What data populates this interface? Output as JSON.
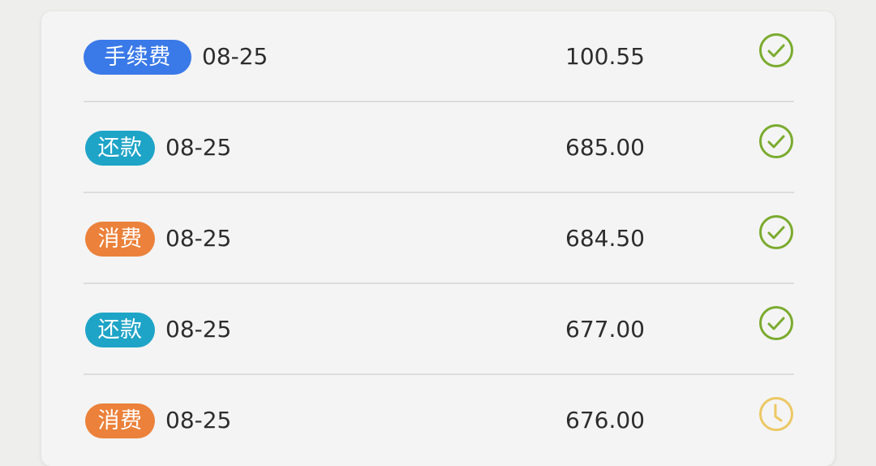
{
  "transactions": [
    {
      "type": "手续费",
      "date": "08-25",
      "amount": "100.55",
      "status": "completed",
      "tag_color": "#3a79e8",
      "status_icon": "check-circle-icon"
    },
    {
      "type": "还款",
      "date": "08-25",
      "amount": "685.00",
      "status": "completed",
      "tag_color": "#1ea4c7",
      "status_icon": "check-circle-icon"
    },
    {
      "type": "消费",
      "date": "08-25",
      "amount": "684.50",
      "status": "completed",
      "tag_color": "#eb813a",
      "status_icon": "check-circle-icon"
    },
    {
      "type": "还款",
      "date": "08-25",
      "amount": "677.00",
      "status": "completed",
      "tag_color": "#1ea4c7",
      "status_icon": "check-circle-icon"
    },
    {
      "type": "消费",
      "date": "08-25",
      "amount": "676.00",
      "status": "pending",
      "tag_color": "#eb813a",
      "status_icon": "clock-icon"
    }
  ],
  "colors": {
    "check_green": "#7bab2f",
    "pending_yellow": "#ecc864",
    "divider": "#dcdcdc",
    "card_bg": "#f4f4f4",
    "page_bg": "#eeeeec"
  }
}
